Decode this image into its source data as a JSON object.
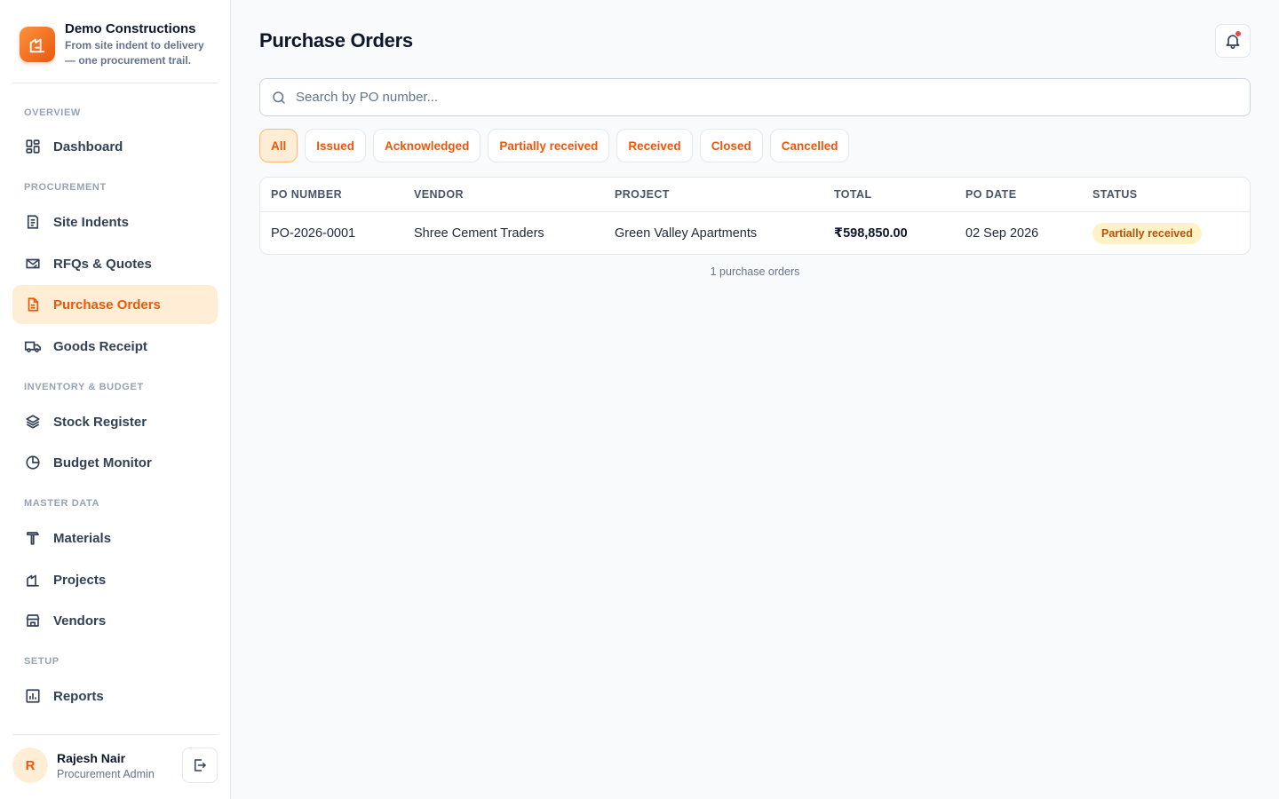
{
  "brand": {
    "name": "Demo Constructions",
    "tagline": "From site indent to delivery — one procurement trail.",
    "logo_icon": "building-icon"
  },
  "sidebar": {
    "sections": [
      {
        "label": "OVERVIEW"
      },
      {
        "label": "PROCUREMENT"
      },
      {
        "label": "INVENTORY & BUDGET"
      },
      {
        "label": "MASTER DATA"
      },
      {
        "label": "SETUP"
      }
    ],
    "items": [
      {
        "label": "Dashboard",
        "icon": "dashboard-icon"
      },
      {
        "label": "Site Indents",
        "icon": "document-list-icon"
      },
      {
        "label": "RFQs & Quotes",
        "icon": "mail-send-icon"
      },
      {
        "label": "Purchase Orders",
        "icon": "document-icon",
        "active": true
      },
      {
        "label": "Goods Receipt",
        "icon": "truck-icon"
      },
      {
        "label": "Stock Register",
        "icon": "layers-icon"
      },
      {
        "label": "Budget Monitor",
        "icon": "pie-chart-icon"
      },
      {
        "label": "Materials",
        "icon": "hammer-icon"
      },
      {
        "label": "Projects",
        "icon": "building-icon"
      },
      {
        "label": "Vendors",
        "icon": "store-icon"
      },
      {
        "label": "Reports",
        "icon": "bar-chart-icon"
      }
    ]
  },
  "user": {
    "initial": "R",
    "name": "Rajesh Nair",
    "role": "Procurement Admin"
  },
  "page": {
    "title": "Purchase Orders"
  },
  "search": {
    "placeholder": "Search by PO number...",
    "value": ""
  },
  "filters": [
    {
      "label": "All",
      "active": true
    },
    {
      "label": "Issued"
    },
    {
      "label": "Acknowledged"
    },
    {
      "label": "Partially received"
    },
    {
      "label": "Received"
    },
    {
      "label": "Closed"
    },
    {
      "label": "Cancelled"
    }
  ],
  "table": {
    "columns": [
      "PO NUMBER",
      "VENDOR",
      "PROJECT",
      "TOTAL",
      "PO DATE",
      "STATUS"
    ],
    "rows": [
      {
        "po_number": "PO-2026-0001",
        "vendor": "Shree Cement Traders",
        "project": "Green Valley Apartments",
        "total": "₹598,850.00",
        "po_date": "02 Sep 2026",
        "status": "Partially received"
      }
    ]
  },
  "footer_count": "1 purchase orders",
  "colors": {
    "accent": "#ea580c",
    "accent_light": "#ffedd5",
    "status_partial_bg": "#fef3c7",
    "status_partial_text": "#b45309",
    "notification_dot": "#ef4444"
  }
}
